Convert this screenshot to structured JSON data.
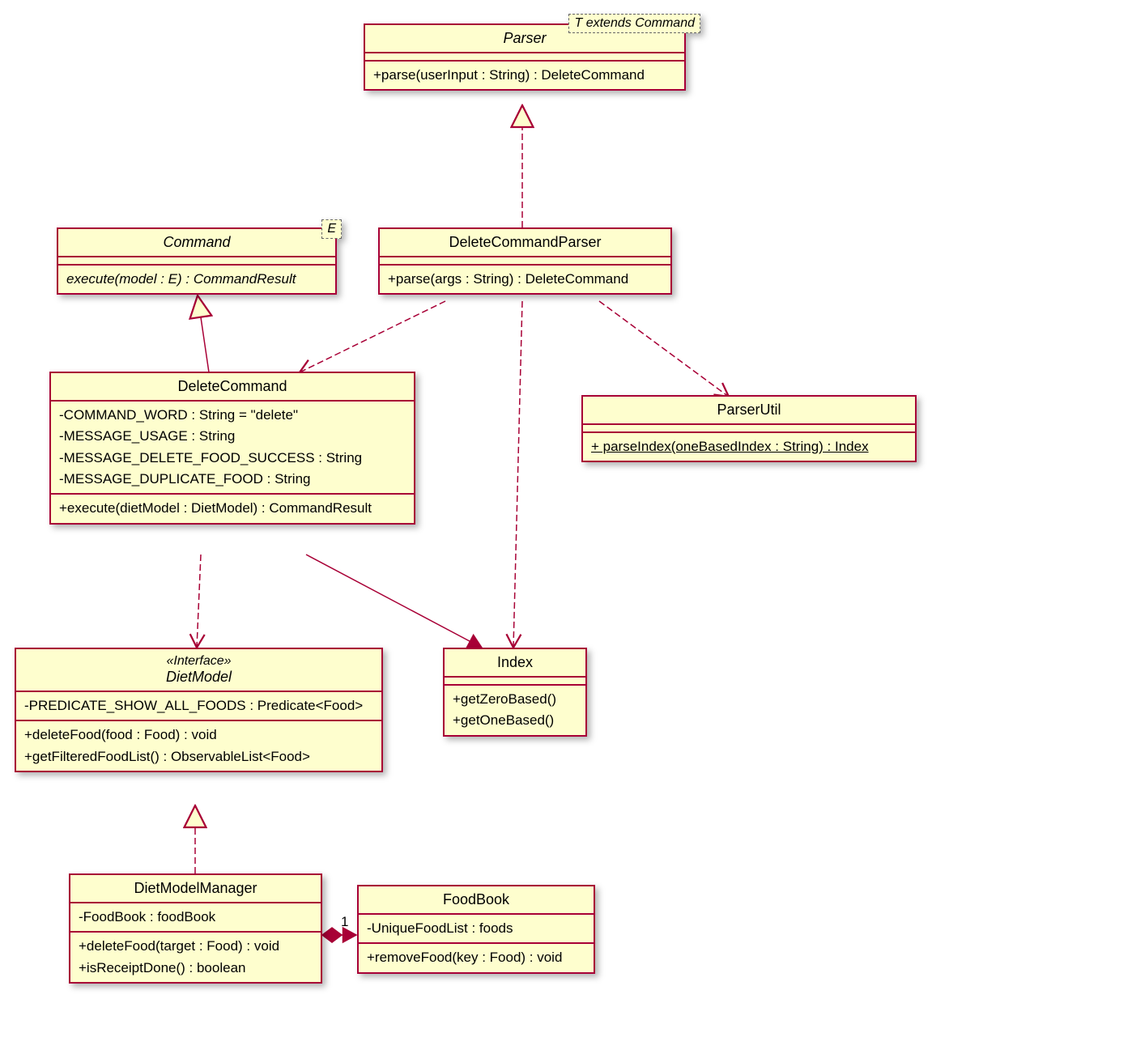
{
  "diagram_type": "UML Class Diagram",
  "classes": {
    "parser": {
      "name": "Parser",
      "template": "T extends Command",
      "methods": [
        "+parse(userInput : String) : DeleteCommand"
      ]
    },
    "command": {
      "name": "Command",
      "template": "E",
      "methods": [
        "execute(model : E) : CommandResult"
      ]
    },
    "deleteCommandParser": {
      "name": "DeleteCommandParser",
      "methods": [
        "+parse(args : String) : DeleteCommand"
      ]
    },
    "deleteCommand": {
      "name": "DeleteCommand",
      "attributes": [
        "-COMMAND_WORD : String = \"delete\"",
        "-MESSAGE_USAGE : String",
        "-MESSAGE_DELETE_FOOD_SUCCESS : String",
        "-MESSAGE_DUPLICATE_FOOD : String"
      ],
      "methods": [
        "+execute(dietModel : DietModel) : CommandResult"
      ]
    },
    "parserUtil": {
      "name": "ParserUtil",
      "methods": [
        "+ parseIndex(oneBasedIndex : String) : Index"
      ]
    },
    "dietModel": {
      "stereotype": "«Interface»",
      "name": "DietModel",
      "attributes": [
        "-PREDICATE_SHOW_ALL_FOODS : Predicate<Food>"
      ],
      "methods": [
        "+deleteFood(food : Food) : void",
        "+getFilteredFoodList() : ObservableList<Food>"
      ]
    },
    "index": {
      "name": "Index",
      "methods": [
        "+getZeroBased()",
        "+getOneBased()"
      ]
    },
    "dietModelManager": {
      "name": "DietModelManager",
      "attributes": [
        "-FoodBook : foodBook"
      ],
      "methods": [
        "+deleteFood(target : Food) : void",
        "+isReceiptDone() : boolean"
      ]
    },
    "foodBook": {
      "name": "FoodBook",
      "attributes": [
        "-UniqueFoodList : foods"
      ],
      "methods": [
        "+removeFood(key : Food) : void"
      ]
    }
  },
  "multiplicities": {
    "dietModelManager_foodBook": "1"
  }
}
